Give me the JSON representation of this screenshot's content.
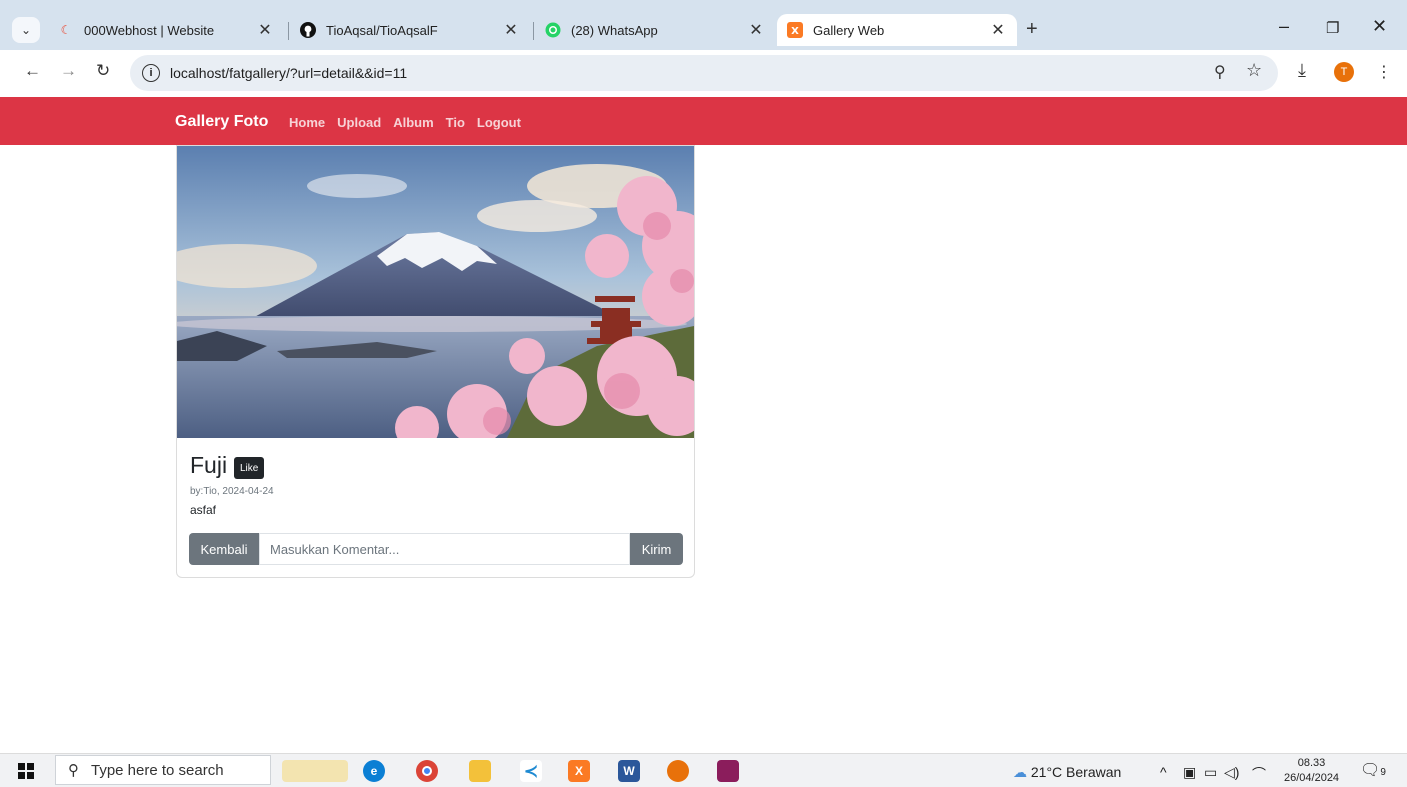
{
  "browser": {
    "tabs": [
      {
        "title": "000Webhost | Website",
        "icon": "webhost-icon",
        "active": false
      },
      {
        "title": "TioAqsal/TioAqsalF",
        "icon": "github-icon",
        "active": false
      },
      {
        "title": "(28) WhatsApp",
        "icon": "whatsapp-icon",
        "active": false
      },
      {
        "title": "Gallery Web",
        "icon": "xampp-icon",
        "active": true
      }
    ],
    "url": "localhost/fatgallery/?url=detail&&id=11"
  },
  "navbar": {
    "brand": "Gallery Foto",
    "links": [
      "Home",
      "Upload",
      "Album",
      "Tio",
      "Logout"
    ],
    "color": "#dc3545"
  },
  "photo": {
    "title": "Fuji",
    "like_label": "Like",
    "meta": "by:Tio, 2024-04-24",
    "description": "asfaf"
  },
  "comment_form": {
    "back_label": "Kembali",
    "placeholder": "Masukkan Komentar...",
    "send_label": "Kirim"
  },
  "taskbar": {
    "search_placeholder": "Type here to search",
    "weather": "21°C  Berawan",
    "time": "08.33",
    "date": "26/04/2024",
    "notification_count": "9"
  }
}
